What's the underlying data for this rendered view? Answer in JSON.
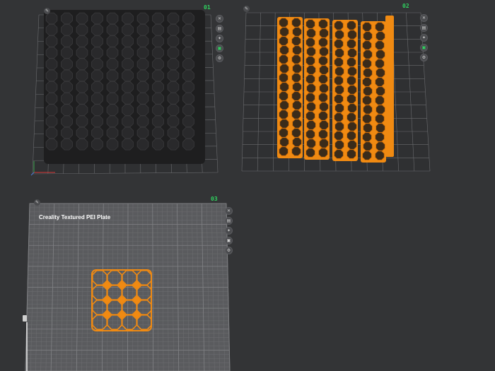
{
  "plates": [
    {
      "id": "plate-1",
      "number": "01"
    },
    {
      "id": "plate-2",
      "number": "02"
    },
    {
      "id": "plate-3",
      "number": "03",
      "title": "Creality Textured PEI Plate"
    }
  ],
  "toolbar_icons": [
    "close-icon",
    "arrange-icon",
    "auto-orient-icon",
    "lock-icon",
    "settings-icon"
  ],
  "icon_glyphs": {
    "close-icon": "✕",
    "arrange-icon": "▤",
    "auto-orient-icon": "✦",
    "lock-icon": "▣",
    "settings-icon": "⚙",
    "pencil-icon": "✎"
  },
  "colors": {
    "background": "#333436",
    "grid_line": "#6a6b6e",
    "model_dark": "#1e1e1f",
    "model_orange": "#f08a12",
    "plate_number": "#2fd35f",
    "bed_surface": "#5a5b5e"
  }
}
